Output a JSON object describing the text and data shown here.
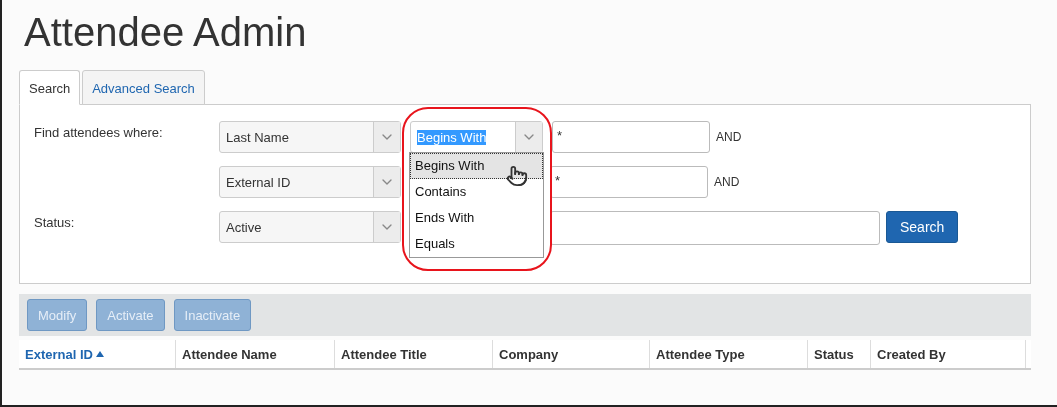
{
  "title": "Attendee Admin",
  "tabs": [
    {
      "label": "Search",
      "selected": true
    },
    {
      "label": "Advanced Search",
      "selected": false
    }
  ],
  "criteria": [
    {
      "label": "Find attendees where:",
      "field": "Last Name",
      "operator": {
        "value": "Begins With",
        "open": true,
        "options": [
          {
            "label": "Begins With",
            "selected": true
          },
          {
            "label": "Contains",
            "selected": false
          },
          {
            "label": "Ends With",
            "selected": false
          },
          {
            "label": "Equals",
            "selected": false
          }
        ]
      },
      "value": "*",
      "conjunction": "AND"
    },
    {
      "field": "External ID",
      "value": "*",
      "conjunction": "AND"
    }
  ],
  "status": {
    "label": "Status:",
    "field": "Active",
    "button": "Search"
  },
  "toolbar": [
    {
      "label": "Modify",
      "disabled": true
    },
    {
      "label": "Activate",
      "disabled": true
    },
    {
      "label": "Inactivate",
      "disabled": true
    }
  ],
  "columns": [
    {
      "label": "External ID",
      "sorted": true
    },
    {
      "label": "Attendee Name",
      "sorted": false
    },
    {
      "label": "Attendee Title",
      "sorted": false
    },
    {
      "label": "Company",
      "sorted": false
    },
    {
      "label": "Attendee Type",
      "sorted": false
    },
    {
      "label": "Status",
      "sorted": false
    },
    {
      "label": "Created By",
      "sorted": false
    }
  ]
}
